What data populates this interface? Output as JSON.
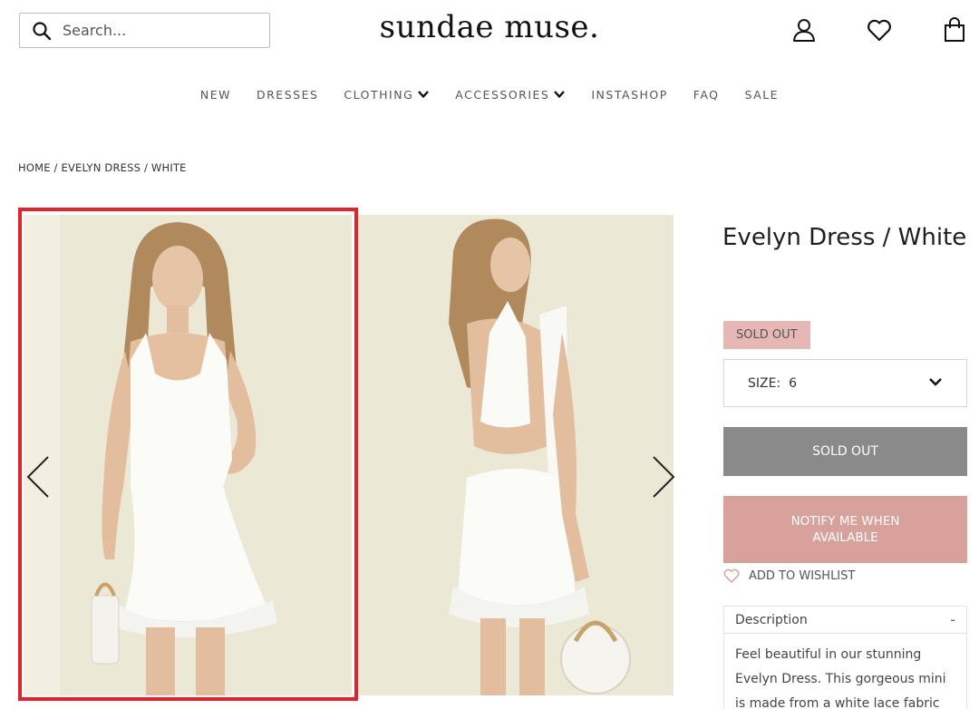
{
  "header": {
    "search_placeholder": "Search...",
    "logo": "sundae muse."
  },
  "nav": {
    "items": [
      "NEW",
      "DRESSES",
      "CLOTHING",
      "ACCESSORIES",
      "INSTASHOP",
      "FAQ",
      "SALE"
    ]
  },
  "breadcrumb": "HOME / EVELYN DRESS / WHITE",
  "product": {
    "title": "Evelyn Dress / White",
    "status_badge": "SOLD OUT",
    "size_label": "SIZE:",
    "size_value": "6",
    "sold_out_button": "SOLD OUT",
    "notify_button": "NOTIFY ME WHEN AVAILABLE",
    "wishlist_link": "ADD TO WISHLIST",
    "description_title": "Description",
    "description_toggle": "-",
    "description_text": "Feel beautiful in our stunning Evelyn Dress. This gorgeous mini is made from a white lace fabric"
  },
  "colors": {
    "badge_bg": "#e6b7b4",
    "sold_out_bg": "#8a8a8a",
    "notify_bg": "#d9a19c",
    "highlight": "#e0232d",
    "photo_bg": "#eeeadb"
  }
}
